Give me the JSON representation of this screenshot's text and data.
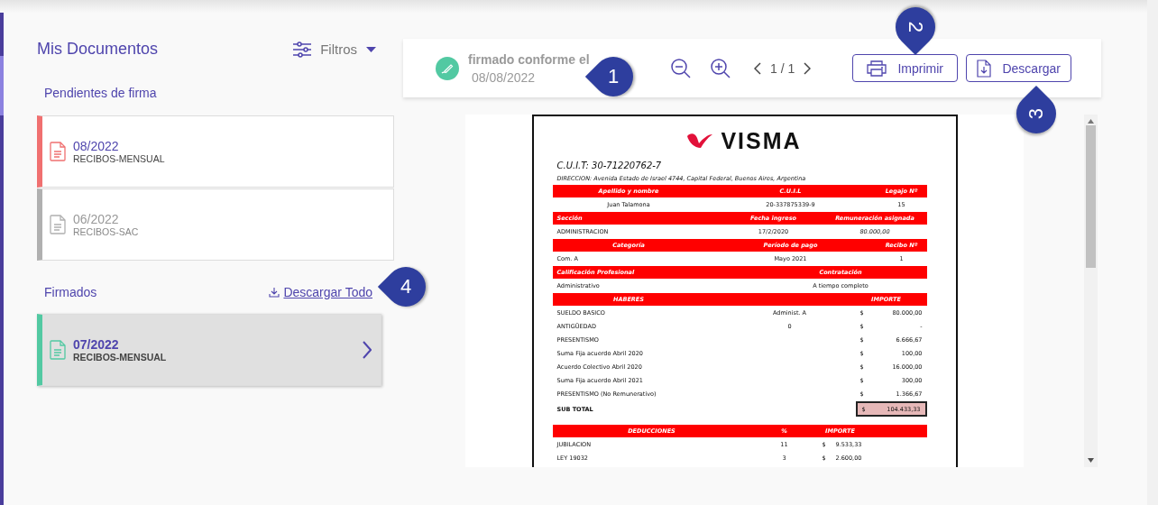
{
  "sidebar": {
    "title": "Mis Documentos",
    "filter_label": "Filtros",
    "sections": [
      {
        "title": "Pendientes de firma",
        "items": [
          {
            "period": "08/2022",
            "type": "RECIBOS-MENSUAL",
            "color": "#f07070",
            "selected": false,
            "muted": false
          },
          {
            "period": "06/2022",
            "type": "RECIBOS-SAC",
            "color": "#b0b0b0",
            "selected": false,
            "muted": true
          }
        ]
      },
      {
        "title": "Firmados",
        "action": "Descargar Todo",
        "items": [
          {
            "period": "07/2022",
            "type": "RECIBOS-MENSUAL",
            "color": "#52c9a2",
            "selected": true,
            "muted": false
          }
        ]
      }
    ]
  },
  "viewer": {
    "signed_label": "firmado conforme el",
    "signed_date": "08/08/2022",
    "page_indicator": "1 / 1",
    "buttons": [
      {
        "kind": "print",
        "label": "Imprimir"
      },
      {
        "kind": "download",
        "label": "Descargar"
      }
    ]
  },
  "document": {
    "logo_text": "VISMA",
    "cuit": "C.U.I.T: 30-71220762-7",
    "address": "DIRECCION: Avenida Estado de Israel 4744, Capital Federal, Buenos Aires, Argentina",
    "rows": [
      {
        "kind": "id-head",
        "cells": [
          "Apellido y nombre",
          "C.U.I.L",
          "Legajo Nº"
        ]
      },
      {
        "kind": "id-row",
        "cells": [
          "Juan Talamona",
          "20-337875339-9",
          "15"
        ]
      },
      {
        "kind": "section-head",
        "cells": [
          "Sección",
          "Fecha ingreso",
          "Remuneración asignada"
        ]
      },
      {
        "kind": "section-row",
        "cells": [
          "ADMINISTRACION",
          "17/2/2020",
          "80.000,00"
        ]
      },
      {
        "kind": "id-head",
        "cells": [
          "Categoría",
          "Período de pago",
          "Recibo Nº"
        ]
      },
      {
        "kind": "id-row-left",
        "cells": [
          "Com. A",
          "Mayo 2021",
          "1"
        ]
      },
      {
        "kind": "pair-head",
        "cells": [
          "Calificación Profesional",
          "Contratación"
        ]
      },
      {
        "kind": "pair-row",
        "cells": [
          "Administrativo",
          "A tiempo completo"
        ]
      },
      {
        "kind": "earnings-head",
        "cells": [
          "HABERES",
          "IMPORTE"
        ]
      },
      {
        "kind": "earning",
        "cells": [
          "SUELDO BASICO",
          "Administ. A",
          "$",
          "80.000,00"
        ]
      },
      {
        "kind": "earning",
        "cells": [
          "ANTIGÜEDAD",
          "0",
          "$",
          "-"
        ]
      },
      {
        "kind": "earning",
        "cells": [
          "PRESENTISMO",
          null,
          "$",
          "6.666,67"
        ]
      },
      {
        "kind": "earning",
        "cells": [
          "Suma Fija acuerdo Abril 2020",
          null,
          "$",
          "100,00"
        ]
      },
      {
        "kind": "earning",
        "cells": [
          "Acuerdo Colectivo Abril 2020",
          null,
          "$",
          "16.000,00"
        ]
      },
      {
        "kind": "earning",
        "cells": [
          "Suma Fija acuerdo Abril 2021",
          null,
          "$",
          "300,00"
        ]
      },
      {
        "kind": "earning",
        "cells": [
          "PRESENTISMO (No Remunerativo)",
          null,
          "$",
          "1.366,67"
        ]
      },
      {
        "kind": "subtotal",
        "cells": [
          "SUB TOTAL",
          "$",
          "104.433,33"
        ]
      },
      {
        "kind": "deductions-head",
        "cells": [
          "DEDUCCIONES",
          "%",
          "IMPORTE"
        ]
      },
      {
        "kind": "deduction",
        "cells": [
          "JUBILACION",
          "11",
          "$",
          "9.533,33"
        ]
      },
      {
        "kind": "deduction",
        "cells": [
          "LEY 19032",
          "3",
          "$",
          "2.600,00"
        ]
      }
    ]
  },
  "callouts": [
    {
      "number": "1"
    },
    {
      "number": "2"
    },
    {
      "number": "3"
    },
    {
      "number": "4"
    }
  ]
}
